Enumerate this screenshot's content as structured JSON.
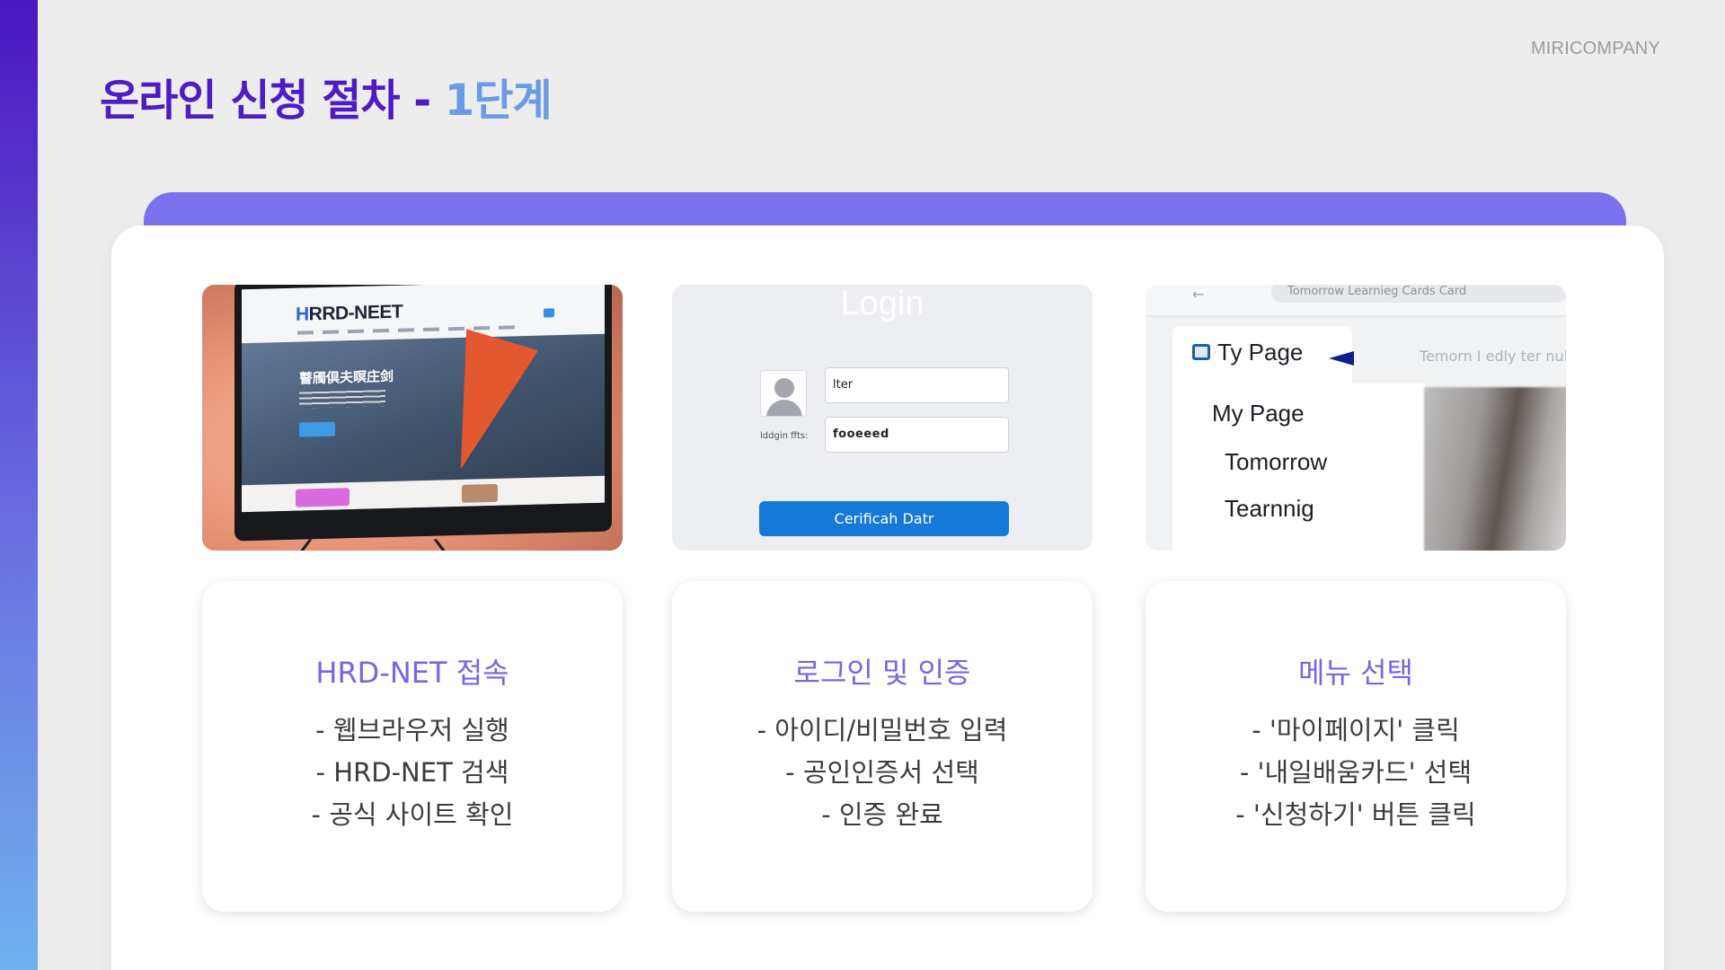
{
  "brand": "MIRICOMPANY",
  "title": {
    "main": "온라인 신청 절차 - ",
    "step": "1단계"
  },
  "colors": {
    "accent": "#7b71ec",
    "title_main": "#4d1cc4",
    "title_step": "#6a9be8",
    "card_title": "#7a63e4",
    "login_button": "#1479d8"
  },
  "screenshots": {
    "hrd": {
      "logo_first": "H",
      "logo_rest": "RRD-NEET",
      "headline": "瞽斶倶夫瞑庄剑"
    },
    "login": {
      "title": "Login",
      "username_value": "lter",
      "password_label": "lddgin ffts:",
      "password_value": "fooeeed",
      "button_label": "Cerificah Datr"
    },
    "menu": {
      "address_bar": "Tomorrow Learnieg Cards Card",
      "tab_label": "Ty Page",
      "faint_text": "Temorn I edly ter nul",
      "items": [
        "My Page",
        "Tomorrow",
        "Tearnnig"
      ]
    }
  },
  "cards": [
    {
      "title": "HRD-NET 접속",
      "lines": [
        "- 웹브라우저 실행",
        "- HRD-NET 검색",
        "- 공식 사이트 확인"
      ]
    },
    {
      "title": "로그인 및 인증",
      "lines": [
        "- 아이디/비밀번호 입력",
        "- 공인인증서 선택",
        "- 인증 완료"
      ]
    },
    {
      "title": "메뉴 선택",
      "lines": [
        "- '마이페이지' 클릭",
        "- '내일배움카드' 선택",
        "- '신청하기' 버튼 클릭"
      ]
    }
  ]
}
